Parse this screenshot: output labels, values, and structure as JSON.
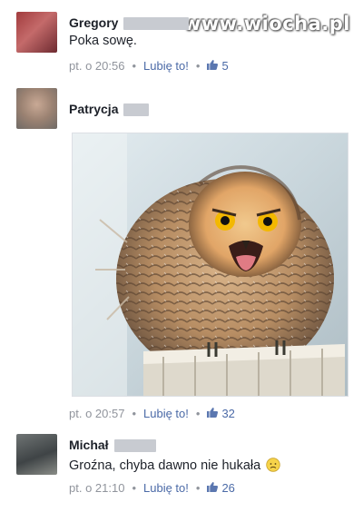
{
  "watermark": "www.wiocha.pl",
  "comments": [
    {
      "author": "Gregory",
      "text": "Poka sowę.",
      "time": "pt. o 20:56",
      "like_label": "Lubię to!",
      "likes": "5"
    },
    {
      "author": "Patrycja",
      "text": "",
      "time": "pt. o 20:57",
      "like_label": "Lubię to!",
      "likes": "32"
    },
    {
      "author": "Michał",
      "text": "Groźna, chyba dawno nie hukała",
      "time": "pt. o 21:10",
      "like_label": "Lubię to!",
      "likes": "26"
    }
  ],
  "separator": "•",
  "icons": {
    "like": "thumbs-up-icon",
    "emoji": "sad-face-icon"
  },
  "colors": {
    "author": "#1d2129",
    "meta": "#90949c",
    "link": "#4b6aa7"
  }
}
